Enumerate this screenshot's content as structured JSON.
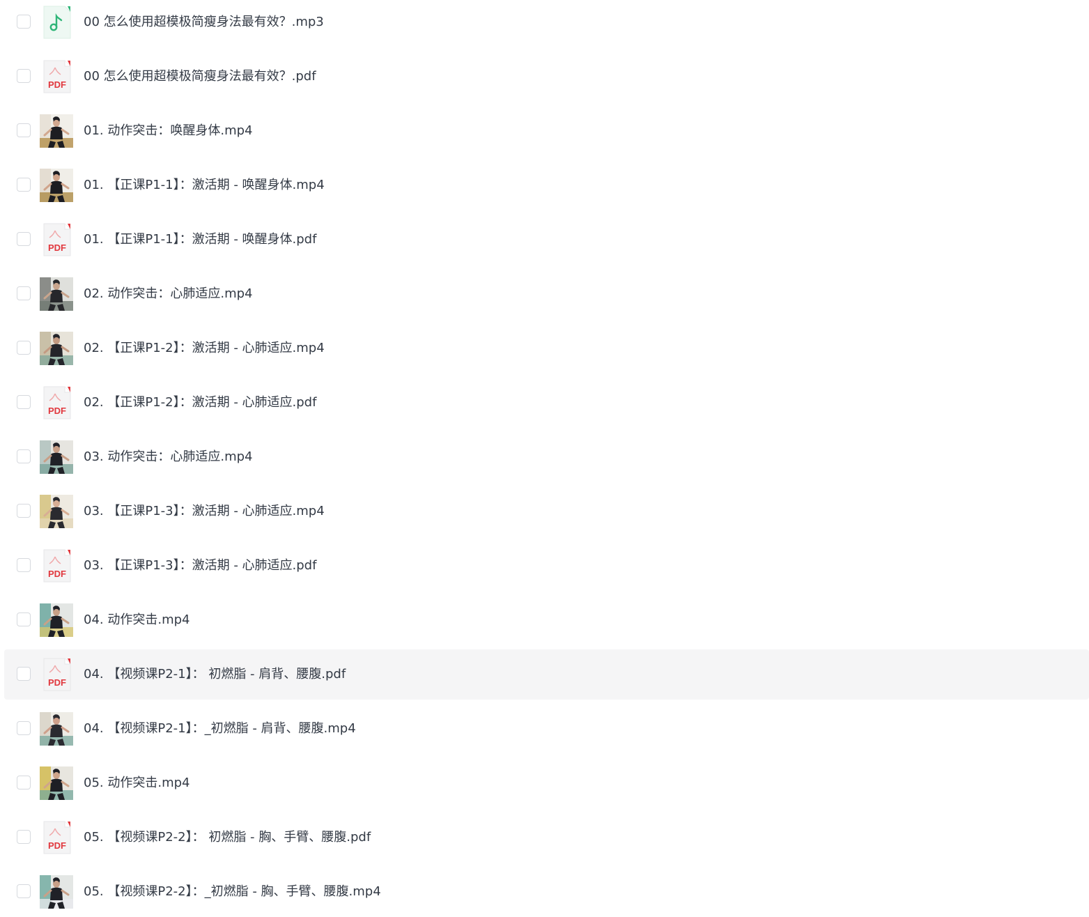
{
  "files": [
    {
      "name": "00 怎么使用超模极简瘦身法最有效？.mp3",
      "type": "audio",
      "icon": "music-note-icon"
    },
    {
      "name": "00 怎么使用超模极简瘦身法最有效？.pdf",
      "type": "pdf",
      "icon": "pdf-file-icon",
      "badge": "PDF"
    },
    {
      "name": "01. 动作突击：唤醒身体.mp4",
      "type": "video",
      "icon": "video-thumbnail",
      "palette": [
        "#f1efe9",
        "#e8e2d8",
        "#1d1d22",
        "#d2a88f",
        "#b08a42"
      ]
    },
    {
      "name": "01. 【正课P1-1】：激活期 - 唤醒身体.mp4",
      "type": "video",
      "icon": "video-thumbnail",
      "palette": [
        "#f0eee8",
        "#e4ddd2",
        "#1c1c21",
        "#d0a48b",
        "#a9853d"
      ]
    },
    {
      "name": "01. 【正课P1-1】：激活期 - 唤醒身体.pdf",
      "type": "pdf",
      "icon": "pdf-file-icon",
      "badge": "PDF"
    },
    {
      "name": "02. 动作突击：心肺适应.mp4",
      "type": "video",
      "icon": "video-thumbnail",
      "palette": [
        "#dfe0dc",
        "#8b8d89",
        "#26272b",
        "#c9a58d",
        "#6f7a72"
      ]
    },
    {
      "name": "02. 【正课P1-2】：激活期 - 心肺适应.mp4",
      "type": "video",
      "icon": "video-thumbnail",
      "palette": [
        "#e7e3d9",
        "#c9c0a8",
        "#24242a",
        "#c39a82",
        "#7fa79a"
      ]
    },
    {
      "name": "02. 【正课P1-2】：激活期 - 心肺适应.pdf",
      "type": "pdf",
      "icon": "pdf-file-icon",
      "badge": "PDF"
    },
    {
      "name": "03. 动作突击：心肺适应.mp4",
      "type": "video",
      "icon": "video-thumbnail",
      "palette": [
        "#e6e5e0",
        "#b9c8c4",
        "#202127",
        "#c89f87",
        "#79a39a"
      ]
    },
    {
      "name": "03. 【正课P1-3】：激活期 - 心肺适应.mp4",
      "type": "video",
      "icon": "video-thumbnail",
      "palette": [
        "#eeeae1",
        "#d9c98e",
        "#2a2a2f",
        "#d8ae94",
        "#e3d6b6"
      ]
    },
    {
      "name": "03. 【正课P1-3】：激活期 - 心肺适应.pdf",
      "type": "pdf",
      "icon": "pdf-file-icon",
      "badge": "PDF"
    },
    {
      "name": "04. 动作突击.mp4",
      "type": "video",
      "icon": "video-thumbnail",
      "palette": [
        "#e3e6e4",
        "#7fb2aa",
        "#1f2026",
        "#c9a187",
        "#d8c56b"
      ]
    },
    {
      "name": "04. 【视频课P2-1】： 初燃脂 - 肩背、腰腹.pdf",
      "type": "pdf",
      "icon": "pdf-file-icon",
      "badge": "PDF",
      "hovered": true
    },
    {
      "name": "04. 【视频课P2-1】：_初燃脂 - 肩背、腰腹.mp4",
      "type": "video",
      "icon": "video-thumbnail",
      "palette": [
        "#eeece6",
        "#dcd7cc",
        "#2a2a30",
        "#cfa08b",
        "#7aa89d"
      ]
    },
    {
      "name": "05. 动作突击.mp4",
      "type": "video",
      "icon": "video-thumbnail",
      "palette": [
        "#e8e6df",
        "#d6c267",
        "#1e1f25",
        "#cfa58b",
        "#76a89c"
      ]
    },
    {
      "name": "05. 【视频课P2-2】： 初燃脂 - 胸、手臂、腰腹.pdf",
      "type": "pdf",
      "icon": "pdf-file-icon",
      "badge": "PDF"
    },
    {
      "name": "05. 【视频课P2-2】：_初燃脂 - 胸、手臂、腰腹.mp4",
      "type": "video",
      "icon": "video-thumbnail",
      "palette": [
        "#e4e7e5",
        "#86b6ad",
        "#202127",
        "#c8a088",
        "#e9e9ee"
      ]
    }
  ],
  "colors": {
    "row_hover_bg": "#f5f5f6",
    "text": "#333a45",
    "checkbox_border": "#d6d9de",
    "pdf_red": "#e1383e",
    "audio_green": "#2fb578",
    "audio_bg": "#eef8f3"
  }
}
